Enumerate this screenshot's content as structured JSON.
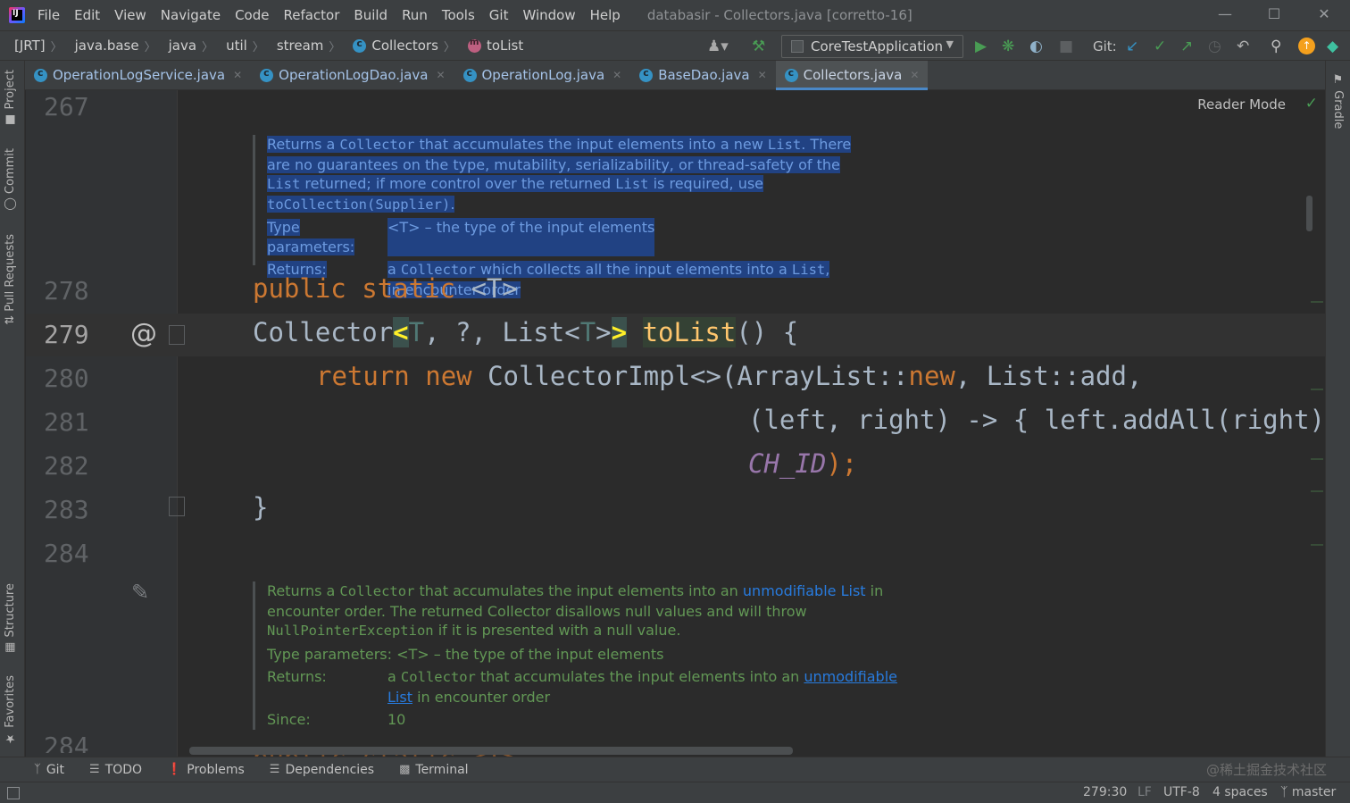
{
  "app": {
    "window_title": "databasir - Collectors.java [corretto-16]",
    "menu": [
      "File",
      "Edit",
      "View",
      "Navigate",
      "Code",
      "Refactor",
      "Build",
      "Run",
      "Tools",
      "Git",
      "Window",
      "Help"
    ]
  },
  "breadcrumb": [
    "[JRT]",
    "java.base",
    "java",
    "util",
    "stream",
    "Collectors",
    "toList"
  ],
  "toolbar": {
    "run_config": "CoreTestApplication",
    "git_label": "Git:"
  },
  "tabs": [
    {
      "label": "OperationLogService.java",
      "active": false
    },
    {
      "label": "OperationLogDao.java",
      "active": false
    },
    {
      "label": "OperationLog.java",
      "active": false
    },
    {
      "label": "BaseDao.java",
      "active": false
    },
    {
      "label": "Collectors.java",
      "active": true
    }
  ],
  "left_tools": [
    "Project",
    "Commit",
    "Pull Requests",
    "Structure",
    "Favorites"
  ],
  "right_tools": [
    "Gradle"
  ],
  "editor": {
    "reader_mode": "Reader Mode",
    "line_numbers": [
      "267",
      "278",
      "279",
      "280",
      "281",
      "282",
      "283",
      "284"
    ],
    "current_line": "279",
    "gutter_marker": "@",
    "doc1": {
      "p1": "Returns a",
      "c1": "Collector",
      "p2": "that accumulates the input elements into a new",
      "c2": "List",
      "p3": ". There are no guarantees on the type, mutability, serializability, or thread-safety of the",
      "c3": "List",
      "p4": "returned; if more control over the returned",
      "c4": "List",
      "p5": "is required, use",
      "c5": "toCollection(Supplier)",
      "p6": ".",
      "type_params_label": "Type parameters:",
      "type_params_value": "<T> – the type of the input elements",
      "returns_label": "Returns:",
      "returns_p1": "a",
      "returns_c1": "Collector",
      "returns_p2": "which collects all the input elements into a",
      "returns_c2": "List",
      "returns_p3": ", in encounter order"
    },
    "doc2": {
      "p1": "Returns a",
      "c1": "Collector",
      "p2": "that accumulates the input elements into an",
      "link1": "unmodifiable List",
      "p3": "in encounter order. The returned Collector disallows null values and will throw",
      "c2": "NullPointerException",
      "p4": "if it is presented with a null value.",
      "type_params_label": "Type parameters:",
      "type_params_value": "<T> – the type of the input elements",
      "returns_label": "Returns:",
      "returns_p1": "a",
      "returns_c1": "Collector",
      "returns_p2": "that accumulates the input elements into an",
      "returns_link": "unmodifiable List",
      "returns_p3": "in encounter order",
      "since_label": "Since:",
      "since_value": "10"
    },
    "code": {
      "l278_kw1": "public",
      "l278_kw2": "static",
      "l278_rest": " <T>",
      "l279_a": "Collector",
      "l279_b": "<",
      "l279_c": "T",
      "l279_d": ", ?, List<",
      "l279_e": "T",
      "l279_f": ">",
      "l279_g": ">",
      "l279_fn": "toList",
      "l279_end": "() {",
      "l280_kw1": "return",
      "l280_kw2": "new",
      "l280_a": " CollectorImpl<>(ArrayList::",
      "l280_kw3": "new",
      "l280_b": ", List::add,",
      "l281": "(left, right) -> { left.addAll(right)",
      "l282_const": "CH_ID",
      "l282_end": ");",
      "l283": "}",
      "partial_next": "public static <T>"
    }
  },
  "bottom_tools": [
    "Git",
    "TODO",
    "Problems",
    "Dependencies",
    "Terminal"
  ],
  "status": {
    "position": "279:30",
    "line_sep": "LF",
    "encoding": "UTF-8",
    "indent": "4 spaces",
    "branch": "master"
  },
  "watermark": "@稀土掘金技术社区"
}
